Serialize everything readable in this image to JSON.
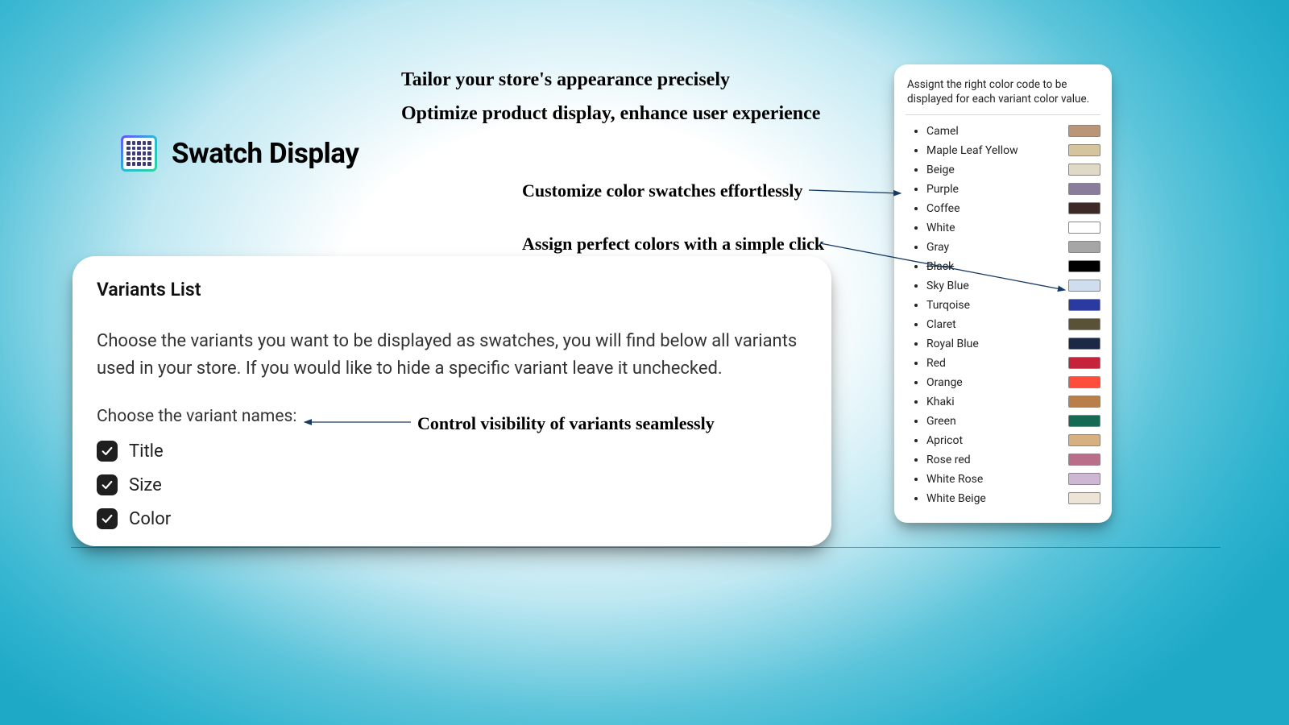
{
  "headlines": {
    "line1": "Tailor your store's appearance precisely",
    "line2": "Optimize product display, enhance user experience"
  },
  "brand": {
    "title": "Swatch Display"
  },
  "callouts": {
    "customize": "Customize color swatches effortlessly",
    "assign": "Assign perfect colors with a simple click",
    "visibility": "Control visibility of variants seamlessly"
  },
  "variants": {
    "title": "Variants List",
    "description": "Choose the variants you want to be displayed as swatches, you will find below all variants used in your store. If you would like to hide a specific variant leave it unchecked.",
    "sublabel": "Choose the variant names:",
    "options": [
      {
        "label": "Title",
        "checked": true
      },
      {
        "label": "Size",
        "checked": true
      },
      {
        "label": "Color",
        "checked": true
      }
    ]
  },
  "colors": {
    "header": "Assignt the right color code to be displayed for each variant color value.",
    "items": [
      {
        "name": "Camel",
        "hex": "#b9967a"
      },
      {
        "name": "Maple Leaf Yellow",
        "hex": "#d6c49e"
      },
      {
        "name": "Beige",
        "hex": "#e0d9c8"
      },
      {
        "name": "Purple",
        "hex": "#8a7c9b"
      },
      {
        "name": "Coffee",
        "hex": "#3d2a26"
      },
      {
        "name": "White",
        "hex": "#ffffff"
      },
      {
        "name": "Gray",
        "hex": "#a6a6a6"
      },
      {
        "name": "Black",
        "hex": "#000000",
        "strike": true
      },
      {
        "name": "Sky Blue",
        "hex": "#cfddee"
      },
      {
        "name": "Turqoise",
        "hex": "#2b3aa0"
      },
      {
        "name": "Claret",
        "hex": "#5a5238"
      },
      {
        "name": "Royal Blue",
        "hex": "#1c2946"
      },
      {
        "name": "Red",
        "hex": "#c5233c"
      },
      {
        "name": "Orange",
        "hex": "#ff4d3d"
      },
      {
        "name": "Khaki",
        "hex": "#b97f4a"
      },
      {
        "name": "Green",
        "hex": "#146a52"
      },
      {
        "name": "Apricot",
        "hex": "#d7b081"
      },
      {
        "name": "Rose red",
        "hex": "#b96f8a"
      },
      {
        "name": "White Rose",
        "hex": "#ceb7d4"
      },
      {
        "name": "White Beige",
        "hex": "#ede4d7"
      }
    ]
  }
}
